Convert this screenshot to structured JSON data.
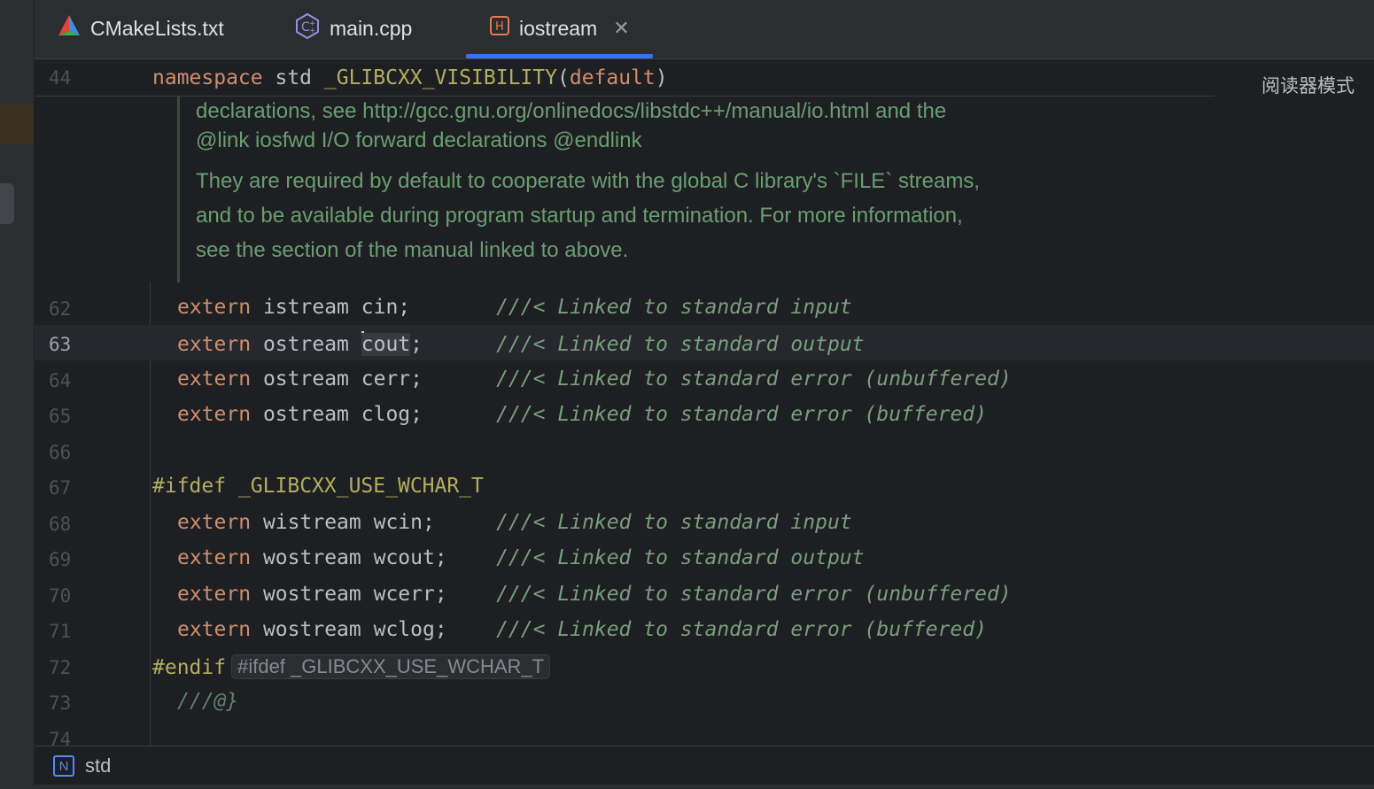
{
  "tabs": [
    {
      "label": "CMakeLists.txt",
      "icon": "cmake-icon"
    },
    {
      "label": "main.cpp",
      "icon": "cpp-file-icon"
    },
    {
      "label": "iostream",
      "icon": "header-file-icon",
      "active": true
    }
  ],
  "tab_close_glyph": "✕",
  "reader_mode_label": "阅读器模式",
  "sticky": {
    "line_number": "44",
    "kw": "namespace",
    "name": " std ",
    "macro": "_GLIBCXX_VISIBILITY",
    "open": "(",
    "arg": "default",
    "close": ")"
  },
  "doc": {
    "line1": "declarations, see http://gcc.gnu.org/onlinedocs/libstdc++/manual/io.html and the",
    "line2": "@link iosfwd I/O forward declarations @endlink",
    "para2_line1": "They are required by default to cooperate with the global C library's `FILE` streams,",
    "para2_line2": "and to be available during program startup and termination. For more information,",
    "para2_line3": "see the section of the manual linked to above."
  },
  "lines": [
    {
      "n": "62",
      "kw": "extern",
      "type": "istream",
      "name": "cin;",
      "pad": "       ",
      "comment": "///< Linked to standard input"
    },
    {
      "n": "63",
      "kw": "extern",
      "type": "ostream",
      "name_pre": "",
      "name_word": "cout",
      "name_post": ";",
      "pad": "      ",
      "comment": "///< Linked to standard output"
    },
    {
      "n": "64",
      "kw": "extern",
      "type": "ostream",
      "name": "cerr;",
      "pad": "      ",
      "comment": "///< Linked to standard error (unbuffered)"
    },
    {
      "n": "65",
      "kw": "extern",
      "type": "ostream",
      "name": "clog;",
      "pad": "      ",
      "comment": "///< Linked to standard error (buffered)"
    },
    {
      "n": "66"
    },
    {
      "n": "67",
      "directive": "#ifdef",
      "macro": "_GLIBCXX_USE_WCHAR_T"
    },
    {
      "n": "68",
      "kw": "extern",
      "type": "wistream",
      "name": "wcin;",
      "pad": "     ",
      "comment": "///< Linked to standard input"
    },
    {
      "n": "69",
      "kw": "extern",
      "type": "wostream",
      "name": "wcout;",
      "pad": "    ",
      "comment": "///< Linked to standard output"
    },
    {
      "n": "70",
      "kw": "extern",
      "type": "wostream",
      "name": "wcerr;",
      "pad": "    ",
      "comment": "///< Linked to standard error (unbuffered)"
    },
    {
      "n": "71",
      "kw": "extern",
      "type": "wostream",
      "name": "wclog;",
      "pad": "    ",
      "comment": "///< Linked to standard error (buffered)"
    },
    {
      "n": "72",
      "directive": "#endif",
      "inlay": "#ifdef _GLIBCXX_USE_WCHAR_T"
    },
    {
      "n": "73",
      "doc_end": "///@}"
    },
    {
      "n": "74"
    }
  ],
  "breadcrumb": {
    "icon_letter": "N",
    "label": "std"
  }
}
